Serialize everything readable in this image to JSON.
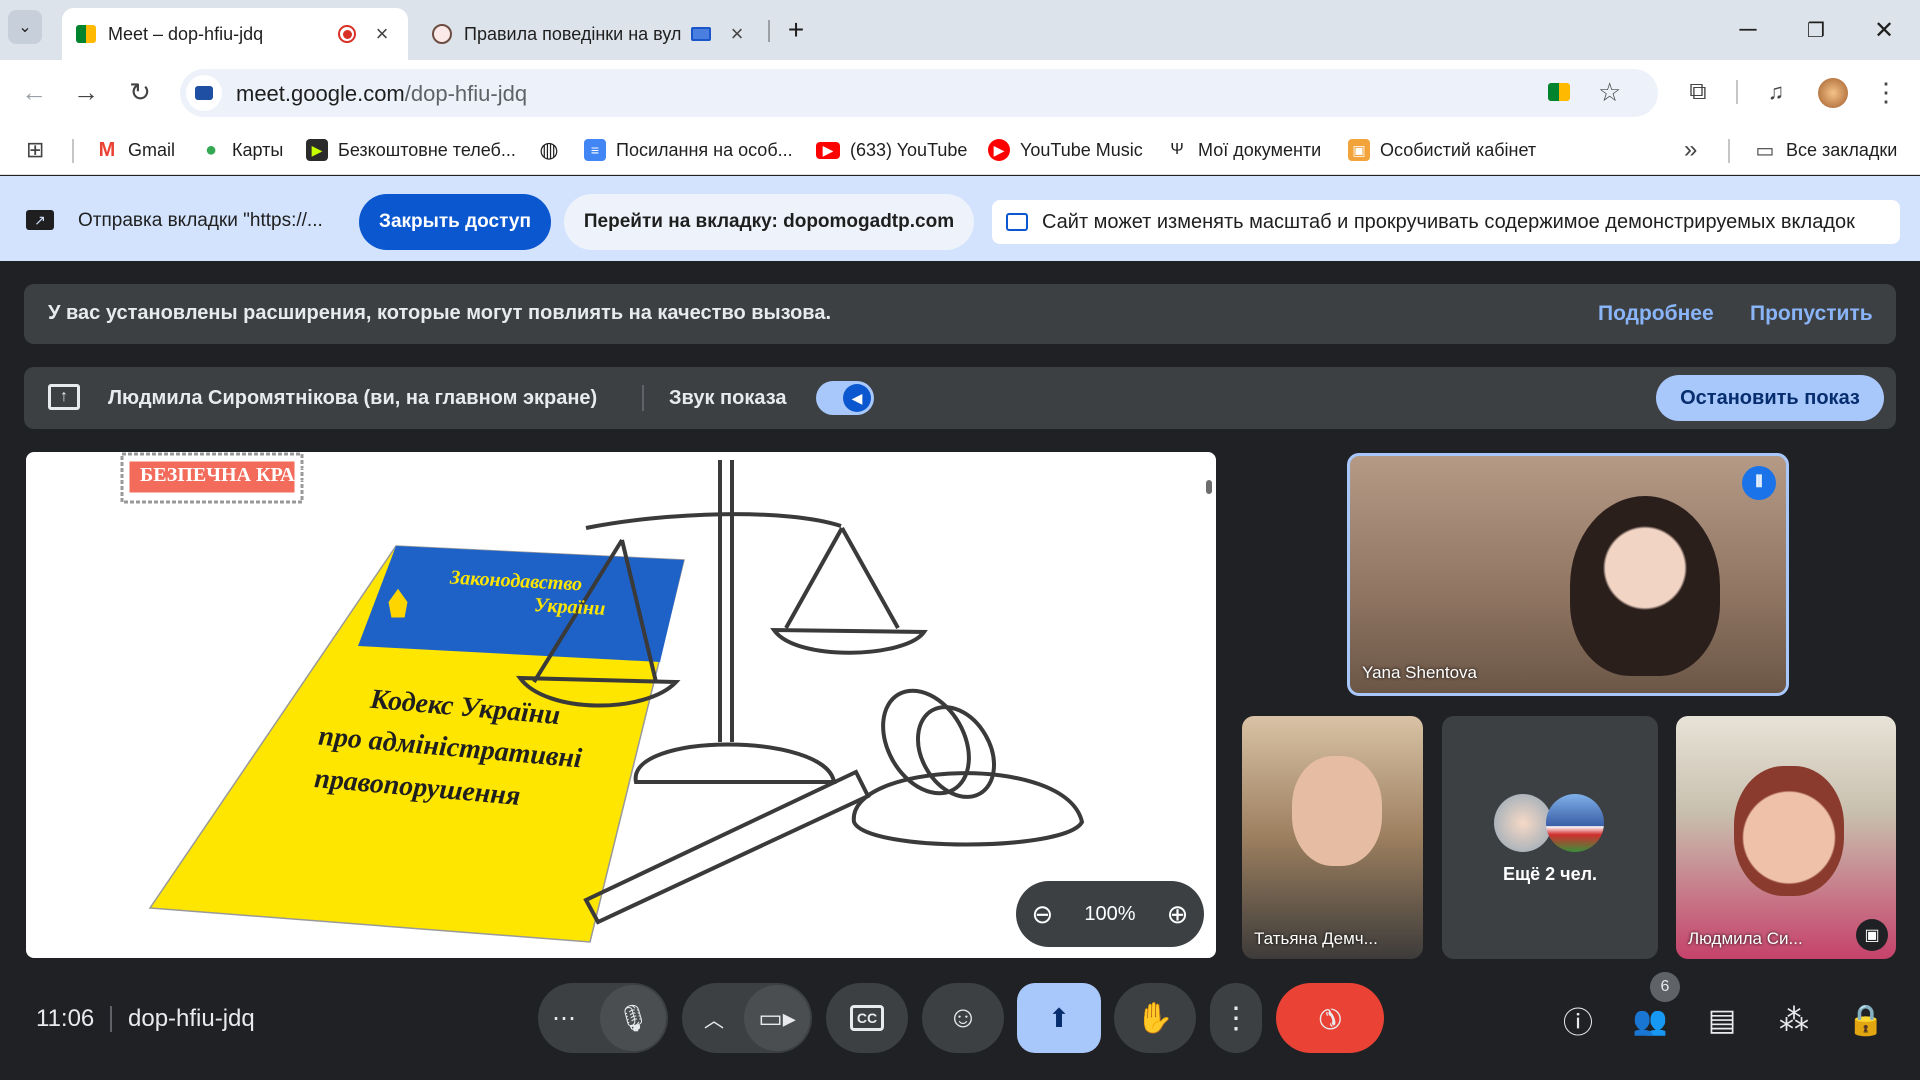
{
  "browser": {
    "tabs": [
      {
        "title": "Meet – dop-hfiu-jdq"
      },
      {
        "title": "Правила поведінки на вул"
      }
    ],
    "url_host": "meet.google.com",
    "url_path": "/dop-hfiu-jdq"
  },
  "bookmarks": [
    {
      "label": "Gmail"
    },
    {
      "label": "Карты"
    },
    {
      "label": "Безкоштовне телеб..."
    },
    {
      "label": "Посилання на особ..."
    },
    {
      "label": "(633) YouTube"
    },
    {
      "label": "YouTube Music"
    },
    {
      "label": "Мої документи"
    },
    {
      "label": "Особистий кабінет"
    },
    {
      "label": "Все закладки"
    }
  ],
  "share_bar": {
    "sending_text": "Отправка вкладки \"https://...",
    "stop_access": "Закрыть доступ",
    "goto_tab": "Перейти на вкладку: dopomogadtp.com",
    "scroll_info": "Сайт может изменять масштаб и прокручивать содержимое демонстрируемых вкладок"
  },
  "extension_banner": {
    "text": "У вас установлены расширения, которые могут повлиять на качество вызова.",
    "more": "Подробнее",
    "skip": "Пропустить"
  },
  "presentation_banner": {
    "presenter": "Людмила Сиромятнікова (ви, на главном экране)",
    "audio_label": "Звук показа",
    "audio_on": true,
    "stop": "Остановить показ"
  },
  "stage": {
    "badge": "БЕЗПЕЧНА КРАЇНА",
    "book_header_1": "Законодавство",
    "book_header_2": "України",
    "book_title_1": "Кодекс України",
    "book_title_2": "про адміністративні",
    "book_title_3": "правопорушення",
    "zoom": "100%"
  },
  "participants": {
    "speaker": "Yana Shentova",
    "tile2": "Татьяна Демч...",
    "more": "Ещё 2 чел.",
    "tile4": "Людмила Си..."
  },
  "bottom": {
    "time": "11:06",
    "meeting_code": "dop-hfiu-jdq",
    "people_count": "6"
  },
  "colors": {
    "accent": "#a8c7fa",
    "hangup": "#ea4335",
    "share_bar": "#d3e3fd",
    "stop_access": "#0b57d0"
  }
}
